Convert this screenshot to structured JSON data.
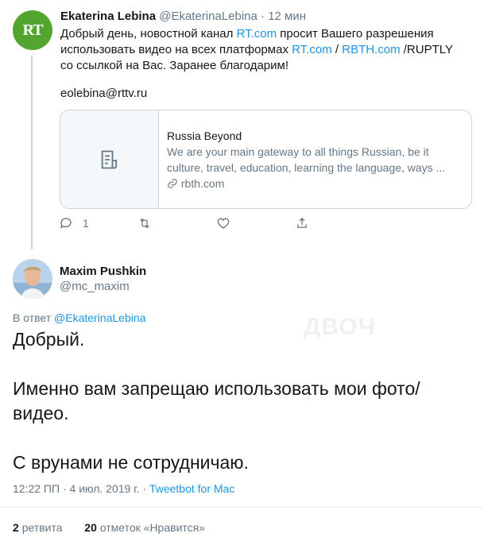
{
  "tweet1": {
    "avatar_text": "RT",
    "name": "Ekaterina Lebina",
    "handle": "@EkaterinaLebina",
    "separator": "·",
    "time": "12 мин",
    "body": {
      "part1": "Добрый день, новостной канал ",
      "link1": "RT.com",
      "part2": " просит Вашего разрешения использовать видео на всех платформах ",
      "link2": "RT.com",
      "slash": " / ",
      "link3": "RBTH.com",
      "part3": " /RUPTLY со ссылкой на Вас. Заранее благодарим!"
    },
    "email": "eolebina@rttv.ru",
    "card": {
      "icon": "document-icon",
      "title": "Russia Beyond",
      "description": "We are your main gateway to all things Russian, be it culture, travel, education, learning the language, ways ...",
      "url": "rbth.com"
    },
    "actions": {
      "reply_count": "1"
    }
  },
  "tweet2": {
    "name": "Maxim Pushkin",
    "handle": "@mc_maxim",
    "reply_prefix": "В ответ ",
    "reply_handle": "@EkaterinaLebina",
    "lines": [
      "Добрый.",
      "Именно вам запрещаю использовать мои фото/видео.",
      "С врунами не сотрудничаю."
    ],
    "watermark": "ДВОЧ",
    "time": "12:22 ПП",
    "date": "4 июл. 2019 г.",
    "separator": "·",
    "client": "Tweetbot for Mac",
    "retweets_count": "2",
    "retweets_label": "ретвита",
    "likes_count": "20",
    "likes_label": "отметок «Нравится»"
  },
  "colors": {
    "link": "#1b95e0",
    "muted": "#657786",
    "text": "#14171a",
    "border": "#ccd6dd",
    "rt_green": "#52a52f"
  }
}
